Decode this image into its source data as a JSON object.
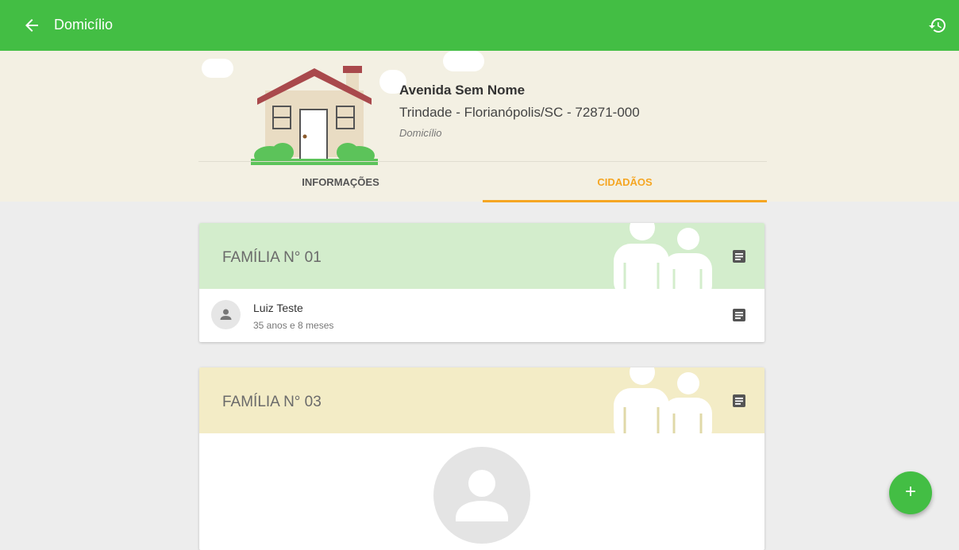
{
  "appbar": {
    "title": "Domicílio",
    "back_icon": "arrow-back-icon",
    "history_icon": "history-icon",
    "color": "#43be44"
  },
  "address": {
    "street": "Avenida Sem Nome",
    "city_line": "Trindade - Florianópolis/SC - 72871-000",
    "type": "Domicílio"
  },
  "tabs": [
    {
      "label": "INFORMAÇÕES",
      "active": false
    },
    {
      "label": "CIDADÃOS",
      "active": true
    }
  ],
  "families": [
    {
      "title": "FAMÍLIA N° 01",
      "header_color": "#d3edcc",
      "members": [
        {
          "name": "Luiz Teste",
          "age": "35 anos e 8 meses"
        }
      ]
    },
    {
      "title": "FAMÍLIA N° 03",
      "header_color": "#f3ecc6",
      "members": []
    }
  ],
  "fab": {
    "label": "+",
    "icon": "add-icon"
  }
}
